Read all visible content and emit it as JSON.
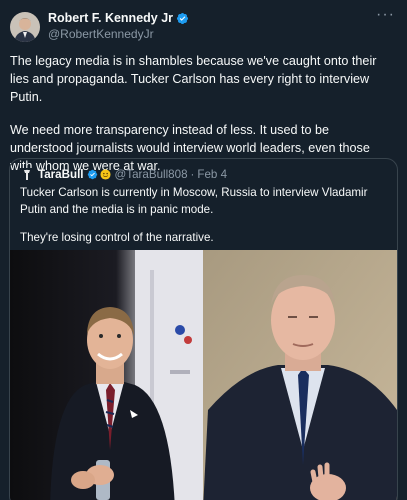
{
  "post": {
    "author_name": "Robert F. Kennedy Jr",
    "author_handle": "@RobertKennedyJr",
    "paragraphs": [
      "The legacy media is in shambles because we've caught onto their lies and propaganda. Tucker Carlson has every right to interview Putin.",
      "We need more transparency instead of less. It used to be understood journalists would interview world leaders, even those with whom we were at war."
    ],
    "more_icon": "more-horizontal-icon"
  },
  "quote": {
    "author_name": "TaraBull",
    "author_handle": "@TaraBull808",
    "separator": "·",
    "date": "Feb 4",
    "paragraphs": [
      "Tucker Carlson is currently in Moscow, Russia to interview Vladamir Putin and the media is in panic mode.",
      "They're losing control of the narrative."
    ]
  },
  "colors": {
    "background": "#15202b",
    "text": "#f7f9f9",
    "muted": "#8b98a5",
    "verified_blue": "#1d9bf0",
    "border": "#38444d"
  }
}
